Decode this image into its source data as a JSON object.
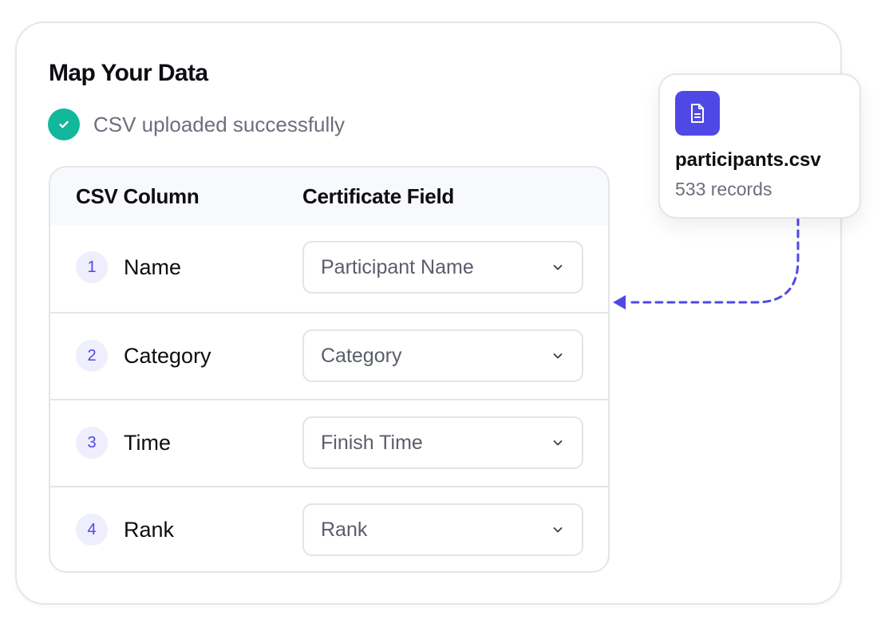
{
  "page": {
    "title": "Map Your Data",
    "status_text": "CSV uploaded successfully"
  },
  "table": {
    "headers": {
      "csv_column": "CSV Column",
      "certificate_field": "Certificate Field"
    },
    "rows": [
      {
        "number": "1",
        "column": "Name",
        "field": "Participant Name"
      },
      {
        "number": "2",
        "column": "Category",
        "field": "Category"
      },
      {
        "number": "3",
        "column": "Time",
        "field": "Finish Time"
      },
      {
        "number": "4",
        "column": "Rank",
        "field": "Rank"
      }
    ]
  },
  "file": {
    "name": "participants.csv",
    "records": "533 records",
    "icon": "document-icon"
  },
  "colors": {
    "accent": "#5048e5",
    "success": "#13b79b",
    "text_primary": "#0d0d12",
    "text_muted": "#6b6f7b",
    "border": "#e4e5e9",
    "header_bg": "#f8f9fc"
  }
}
